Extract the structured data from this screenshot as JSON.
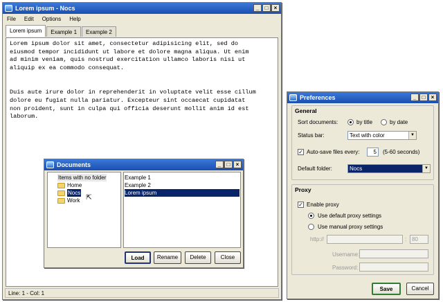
{
  "main": {
    "title": "Lorem ipsum - Nocs",
    "menu": [
      "File",
      "Edit",
      "Options",
      "Help"
    ],
    "tabs": [
      "Lorem ipsum",
      "Example 1",
      "Example 2"
    ],
    "text": "Lorem ipsum dolor sit amet, consectetur adipisicing elit, sed do\neiusmod tempor incididunt ut labore et dolore magna aliqua. Ut enim\nad minim veniam, quis nostrud exercitation ullamco laboris nisi ut\naliquip ex ea commodo consequat.\n\n\nDuis aute irure dolor in reprehenderit in voluptate velit esse cillum\ndolore eu fugiat nulla pariatur. Excepteur sint occaecat cupidatat\nnon proident, sunt in culpa qui officia deserunt mollit anim id est\nlaborum.",
    "status": "Line: 1 - Col: 1",
    "window_buttons": [
      "_",
      "□",
      "×"
    ]
  },
  "documents": {
    "title": "Documents",
    "folders": [
      "Items with no folder",
      "Home",
      "Nocs",
      "Work"
    ],
    "files": [
      "Example 1",
      "Example 2",
      "Lorem ipsum"
    ],
    "buttons": {
      "load": "Load",
      "rename": "Rename",
      "delete": "Delete",
      "close": "Close"
    }
  },
  "prefs": {
    "title": "Preferences",
    "general": "General",
    "sort_label": "Sort documents:",
    "by_title": "by title",
    "by_date": "by date",
    "statusbar_label": "Status bar:",
    "statusbar_value": "Text with color",
    "autosave_label": "Auto-save files every:",
    "autosave_value": "5",
    "autosave_range": "(5-60 seconds)",
    "folder_label": "Default folder:",
    "folder_value": "Nocs",
    "proxy": "Proxy",
    "enable_proxy": "Enable proxy",
    "use_default": "Use default proxy settings",
    "use_manual": "Use manual proxy settings",
    "http_label": "http://",
    "port_sep": ":",
    "port_value": "80",
    "username_label": "Username:",
    "password_label": "Password:",
    "save": "Save",
    "cancel": "Cancel"
  }
}
